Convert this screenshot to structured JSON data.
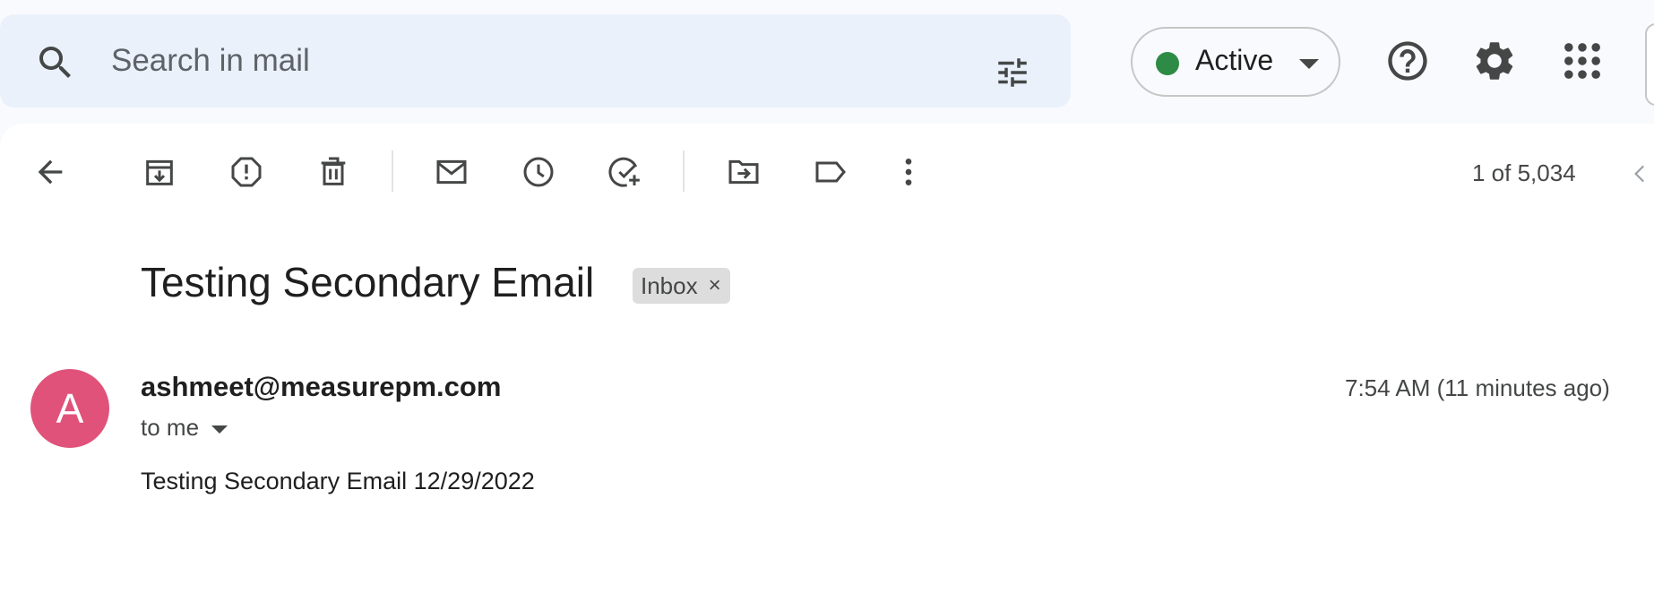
{
  "search": {
    "placeholder": "Search in mail",
    "value": ""
  },
  "status": {
    "label": "Active",
    "color": "#2e8b45"
  },
  "header_icons": [
    "search-icon",
    "search-options-icon",
    "help-icon",
    "settings-icon",
    "apps-icon"
  ],
  "toolbar": {
    "icons": [
      "back-icon",
      "archive-icon",
      "report-spam-icon",
      "delete-icon",
      "mark-unread-icon",
      "snooze-icon",
      "add-to-tasks-icon",
      "move-to-icon",
      "labels-icon",
      "more-icon"
    ],
    "counter": "1 of 5,034"
  },
  "message": {
    "subject": "Testing Secondary Email",
    "label_chip": "Inbox",
    "chip_remove": "×",
    "avatar_letter": "A",
    "avatar_color": "#e0527a",
    "sender": "ashmeet@measurepm.com",
    "recipient": "to me",
    "time": "7:54 AM (11 minutes ago)",
    "body": "Testing Secondary Email 12/29/2022"
  }
}
